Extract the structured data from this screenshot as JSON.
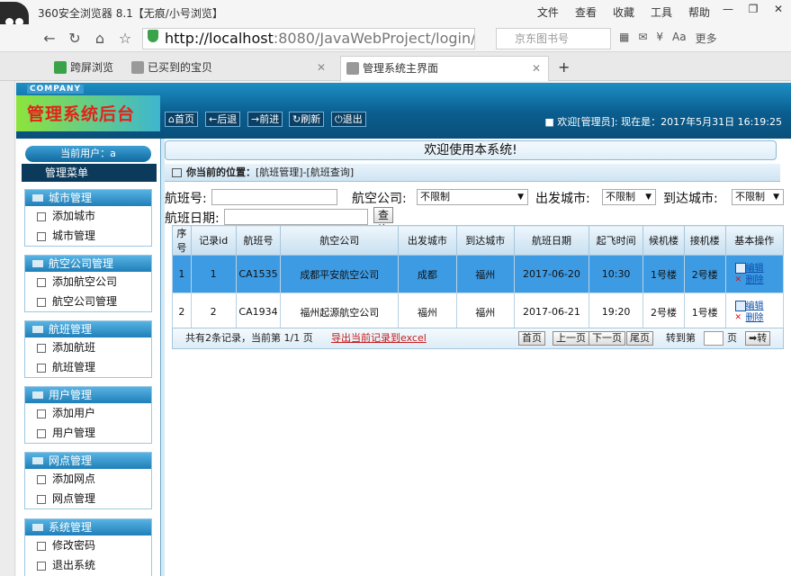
{
  "browser": {
    "title": "360安全浏览器 8.1【无痕/小号浏览】",
    "menu": [
      "文件",
      "查看",
      "收藏",
      "工具",
      "帮助"
    ],
    "url_host": "http://localhost",
    "url_rest": ":8080/JavaWebProject/login/",
    "search_placeholder": "京东图书号",
    "more": "更多",
    "tabs": [
      "跨屏浏览",
      "已买到的宝贝",
      "管理系统主界面"
    ]
  },
  "header": {
    "company": "COMPANY",
    "brand": "管理系统后台",
    "buttons": [
      "首页",
      "后退",
      "前进",
      "刷新",
      "退出"
    ],
    "welcome": "■ 欢迎[管理员]:    现在是：2017年5月31日 16:19:25"
  },
  "sidebar": {
    "user_label": "当前用户：a",
    "menu_title": "管理菜单",
    "groups": [
      {
        "title": "城市管理",
        "items": [
          "添加城市",
          "城市管理"
        ]
      },
      {
        "title": "航空公司管理",
        "items": [
          "添加航空公司",
          "航空公司管理"
        ]
      },
      {
        "title": "航班管理",
        "items": [
          "添加航班",
          "航班管理"
        ]
      },
      {
        "title": "用户管理",
        "items": [
          "添加用户",
          "用户管理"
        ]
      },
      {
        "title": "网点管理",
        "items": [
          "添加网点",
          "网点管理"
        ]
      },
      {
        "title": "系统管理",
        "items": [
          "修改密码",
          "退出系统"
        ]
      }
    ]
  },
  "main": {
    "welcome": "欢迎使用本系统!",
    "position_label": "你当前的位置：",
    "position_path": "[航班管理]-[航班查询]",
    "filters": {
      "flight_no_label": "航班号:",
      "airline_label": "航空公司:",
      "airline_value": "不限制",
      "from_label": "出发城市:",
      "from_value": "不限制",
      "to_label": "到达城市:",
      "to_value": "不限制",
      "date_label": "航班日期:",
      "query_btn": "查询"
    },
    "table": {
      "headers": [
        "序号",
        "记录id",
        "航班号",
        "航空公司",
        "出发城市",
        "到达城市",
        "航班日期",
        "起飞时间",
        "候机楼",
        "接机楼",
        "基本操作"
      ],
      "rows": [
        [
          "1",
          "1",
          "CA1535",
          "成都平安航空公司",
          "成都",
          "福州",
          "2017-06-20",
          "10:30",
          "1号楼",
          "2号楼"
        ],
        [
          "2",
          "2",
          "CA1934",
          "福州起源航空公司",
          "福州",
          "福州",
          "2017-06-21",
          "19:20",
          "2号楼",
          "1号楼"
        ]
      ],
      "edit_label": "编辑",
      "delete_label": "删除"
    },
    "pager": {
      "info": "共有2条记录，当前第 1/1 页",
      "export": "导出当前记录到excel",
      "first": "首页",
      "prev": "上一页",
      "next": "下一页",
      "last": "尾页",
      "goto_label": "转到第",
      "page_unit": "页",
      "go": "➡转"
    }
  }
}
